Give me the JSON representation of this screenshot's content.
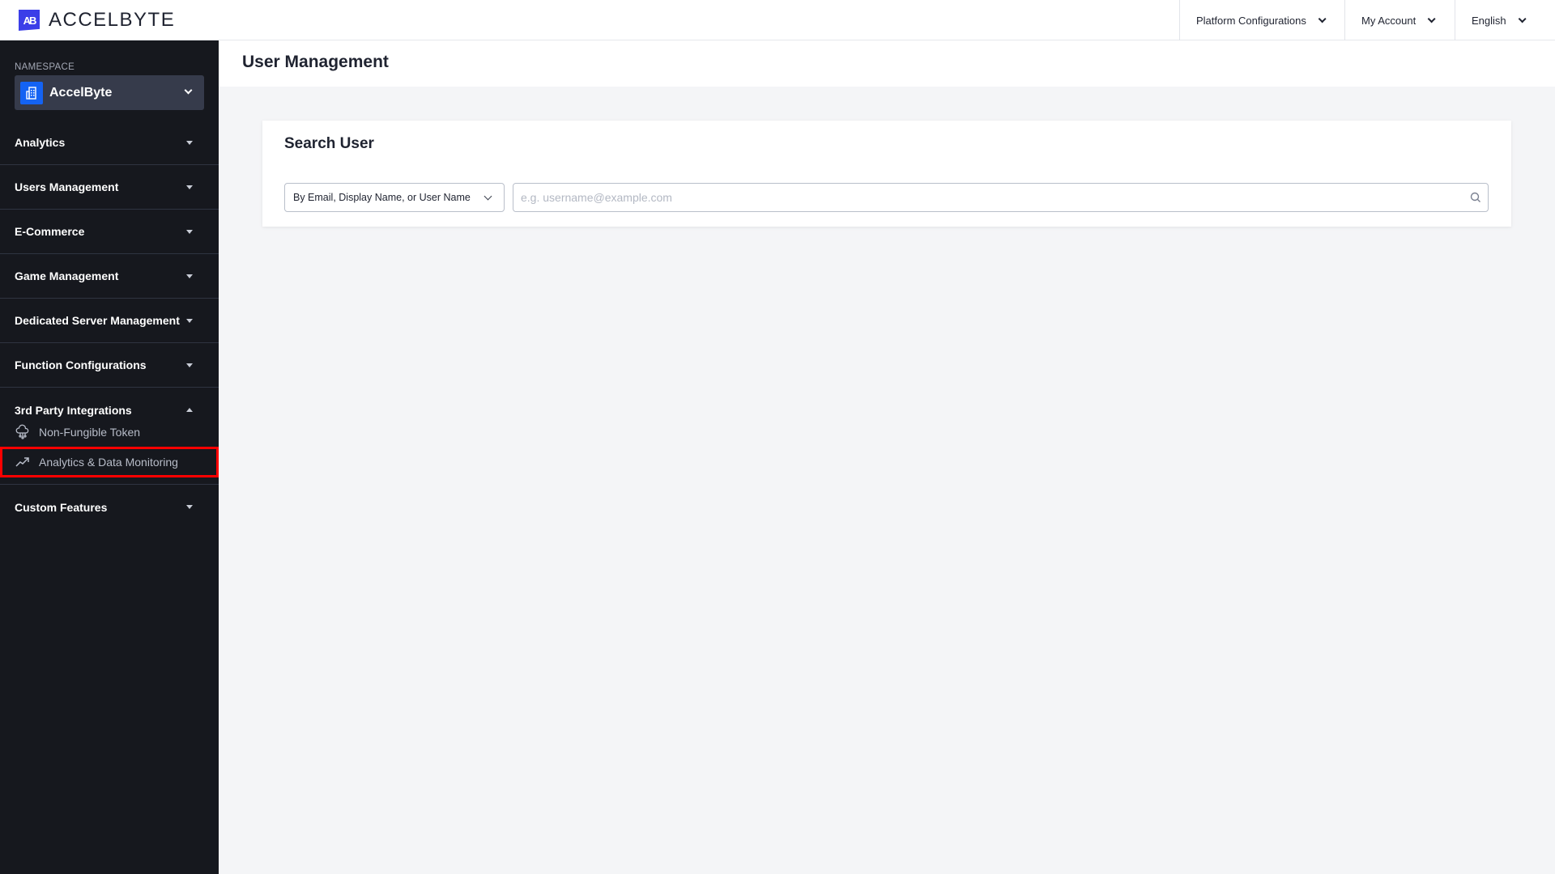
{
  "app": {
    "logo_mark": "AB",
    "logo_text": "ACCELBYTE"
  },
  "topnav": {
    "items": [
      {
        "label": "Platform Configurations",
        "icon": "chevron-down-icon"
      },
      {
        "label": "My Account",
        "icon": "chevron-down-icon"
      },
      {
        "label": "English",
        "icon": "chevron-down-icon"
      }
    ]
  },
  "sidebar": {
    "namespace_label": "NAMESPACE",
    "namespace_value": "AccelByte",
    "items": [
      {
        "label": "Analytics",
        "expanded": false
      },
      {
        "label": "Users Management",
        "expanded": false
      },
      {
        "label": "E-Commerce",
        "expanded": false
      },
      {
        "label": "Game Management",
        "expanded": false
      },
      {
        "label": "Dedicated Server Management",
        "expanded": false
      },
      {
        "label": "Function Configurations",
        "expanded": false
      },
      {
        "label": "3rd Party Integrations",
        "expanded": true,
        "children": [
          {
            "label": "Non-Fungible Token",
            "icon": "cloud-network-icon"
          },
          {
            "label": "Analytics & Data Monitoring",
            "icon": "trending-up-icon",
            "highlighted": true
          }
        ]
      },
      {
        "label": "Custom Features",
        "expanded": false
      }
    ],
    "highlight_color": "#ff0000"
  },
  "main": {
    "page_title": "User Management",
    "search_card": {
      "title": "Search User",
      "search_type_selected": "By Email, Display Name, or User Name",
      "search_value": "",
      "search_placeholder": "e.g. username@example.com"
    }
  },
  "colors": {
    "sidebar_bg": "#16181e",
    "brand": "#3b3ee8",
    "namespace_icon": "#1463f3"
  }
}
